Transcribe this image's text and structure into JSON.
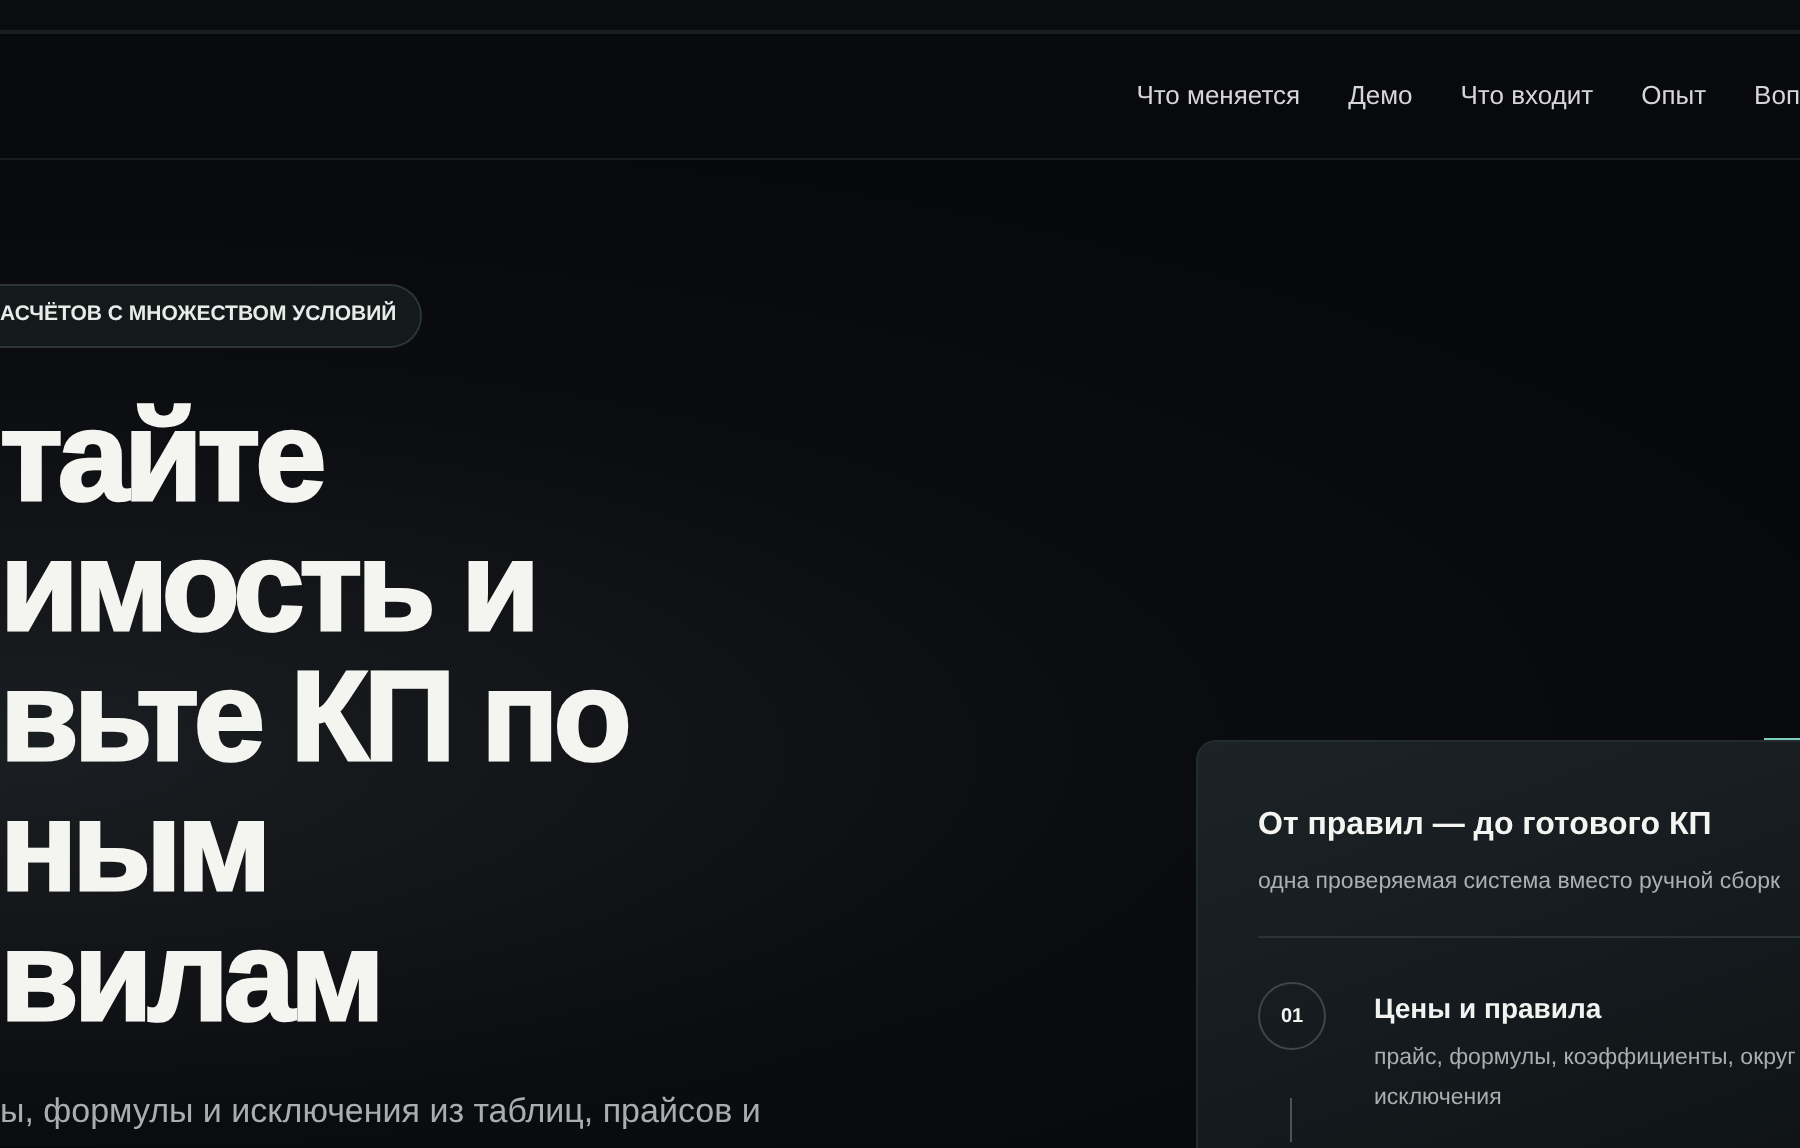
{
  "nav": {
    "items": [
      {
        "label": "Что меняется"
      },
      {
        "label": "Демо"
      },
      {
        "label": "Что входит"
      },
      {
        "label": "Опыт"
      },
      {
        "label": "Воп"
      }
    ]
  },
  "hero": {
    "badge": "АСЧЁТОВ С МНОЖЕСТВОМ УСЛОВИЙ",
    "headline_lines": [
      "тайте",
      "имость и",
      "вьте КП по",
      "ным",
      "вилам"
    ],
    "lead": "ы, формулы и исключения из таблиц, прайсов и"
  },
  "card": {
    "title": "От правил — до готового КП",
    "subtitle": "одна проверяемая система вместо ручной сборк",
    "steps": [
      {
        "number": "01",
        "title": "Цены и правила",
        "description_lines": [
          "прайс, формулы, коэффициенты, округ",
          "исключения"
        ]
      }
    ]
  }
}
